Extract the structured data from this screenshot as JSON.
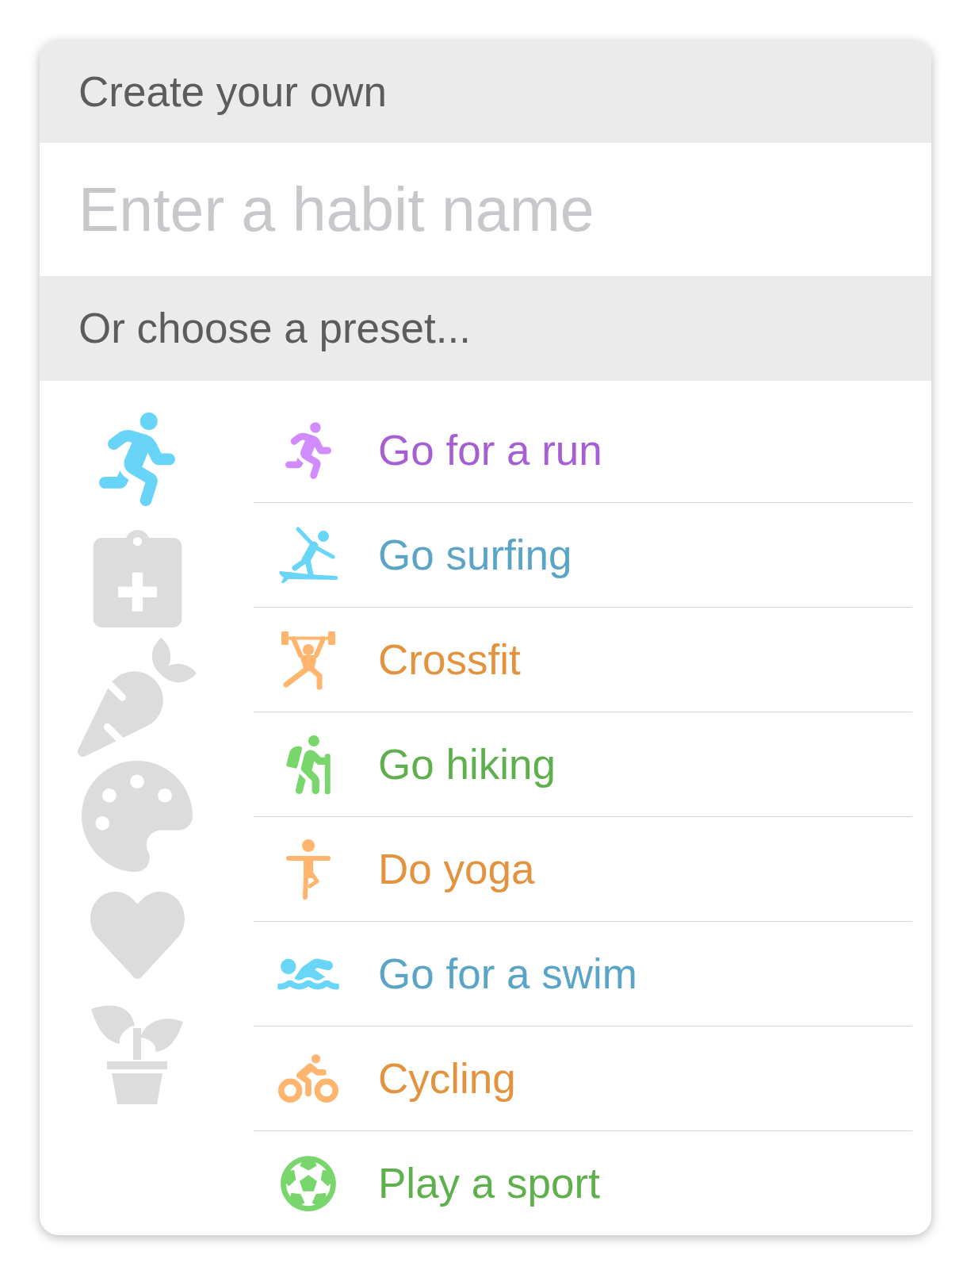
{
  "create_section": {
    "title": "Create your own"
  },
  "habit_name_field": {
    "placeholder": "Enter a habit name"
  },
  "preset_section": {
    "title": "Or choose a preset..."
  },
  "categories": [
    {
      "kind": "runner",
      "selected": true
    },
    {
      "kind": "clipboard",
      "selected": false
    },
    {
      "kind": "carrot",
      "selected": false
    },
    {
      "kind": "palette",
      "selected": false
    },
    {
      "kind": "heart",
      "selected": false
    },
    {
      "kind": "plant",
      "selected": false
    }
  ],
  "presets": [
    {
      "kind": "run",
      "label": "Go for a run",
      "color": "#a65fd3",
      "icon": {
        "color": "#d08cff"
      }
    },
    {
      "kind": "surf",
      "label": "Go surfing",
      "color": "#5aa4c8",
      "icon": {
        "color": "#69d5f7"
      }
    },
    {
      "kind": "crossfit",
      "label": "Crossfit",
      "color": "#e3923e",
      "icon": {
        "color": "#ffb56d"
      }
    },
    {
      "kind": "hike",
      "label": "Go hiking",
      "color": "#5db04c",
      "icon": {
        "color": "#79d66d"
      }
    },
    {
      "kind": "yoga",
      "label": "Do yoga",
      "color": "#e3923e",
      "icon": {
        "color": "#ffb56d"
      }
    },
    {
      "kind": "swim",
      "label": "Go for a swim",
      "color": "#5aa4c8",
      "icon": {
        "color": "#69d5f7"
      }
    },
    {
      "kind": "cycle",
      "label": "Cycling",
      "color": "#e3923e",
      "icon": {
        "color": "#ffb56d"
      }
    },
    {
      "kind": "sport",
      "label": "Play a sport",
      "color": "#5db04c",
      "icon": {
        "color": "#79d66d"
      }
    }
  ]
}
